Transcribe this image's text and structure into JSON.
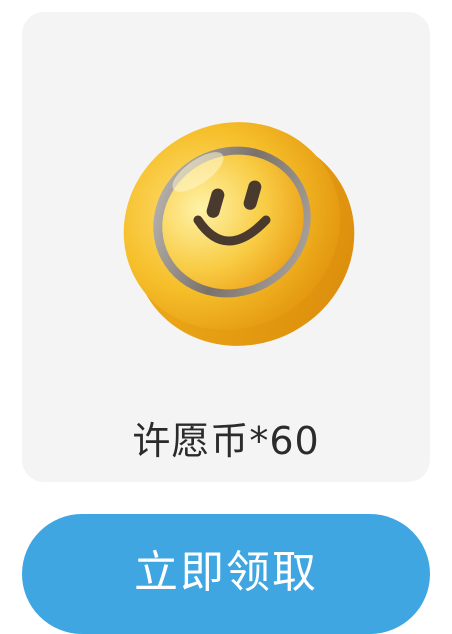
{
  "reward": {
    "icon": "smiley-coin-icon",
    "label": "许愿币*60"
  },
  "claim_button": {
    "label": "立即领取"
  },
  "colors": {
    "card_background": "#f4f4f5",
    "button_blue": "#3fa6e2",
    "coin_gold": "#f2b01e"
  }
}
